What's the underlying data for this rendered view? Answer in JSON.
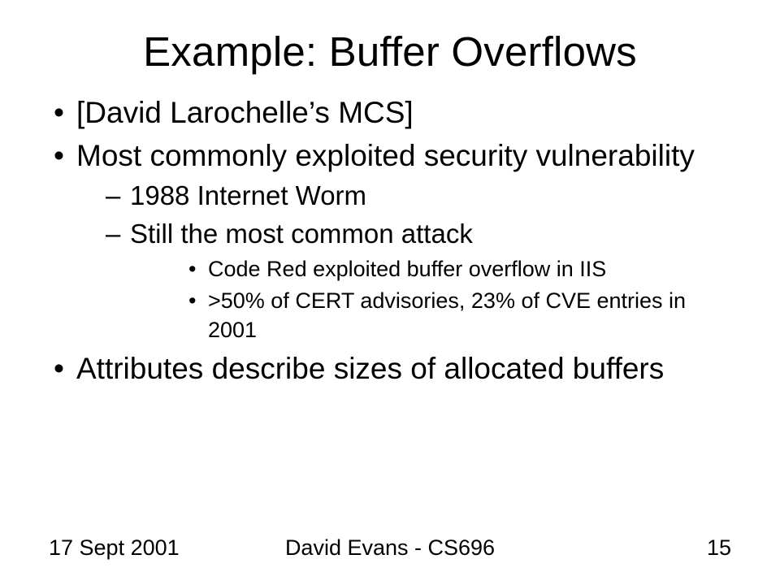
{
  "title": "Example: Buffer Overflows",
  "bullets": {
    "b1": "[David Larochelle’s MCS]",
    "b2": "Most commonly exploited security vulnerability",
    "b2_1": "1988 Internet Worm",
    "b2_2": "Still the most common attack",
    "b2_2_1": "Code Red exploited buffer overflow in IIS",
    "b2_2_2": ">50% of CERT advisories, 23% of CVE entries in 2001",
    "b3": "Attributes describe sizes of allocated buffers"
  },
  "footer": {
    "left": "17 Sept 2001",
    "center": "David Evans - CS696",
    "right": "15"
  }
}
